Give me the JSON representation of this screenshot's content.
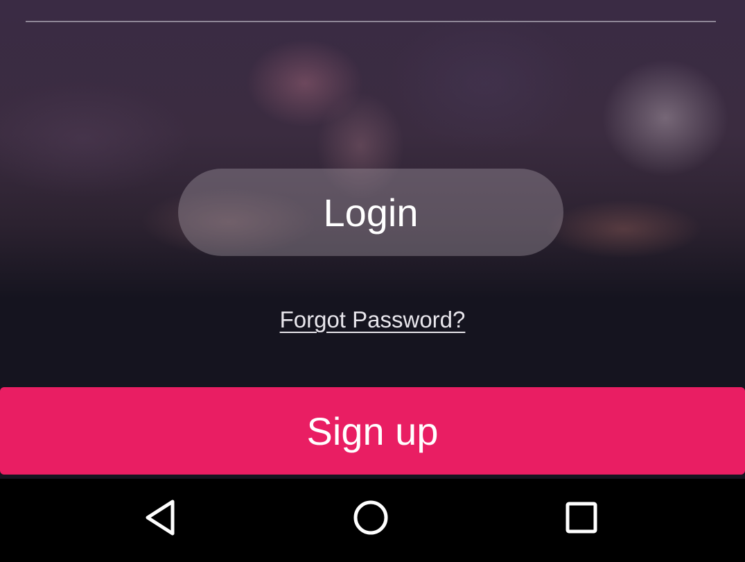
{
  "login": {
    "label": "Login"
  },
  "forgot_password": {
    "label": "Forgot Password?"
  },
  "signup": {
    "label": "Sign up",
    "color": "#e91e63"
  },
  "nav_bar": {
    "buttons": [
      {
        "icon": "back-triangle-icon"
      },
      {
        "icon": "home-circle-icon"
      },
      {
        "icon": "recents-square-icon"
      }
    ]
  }
}
